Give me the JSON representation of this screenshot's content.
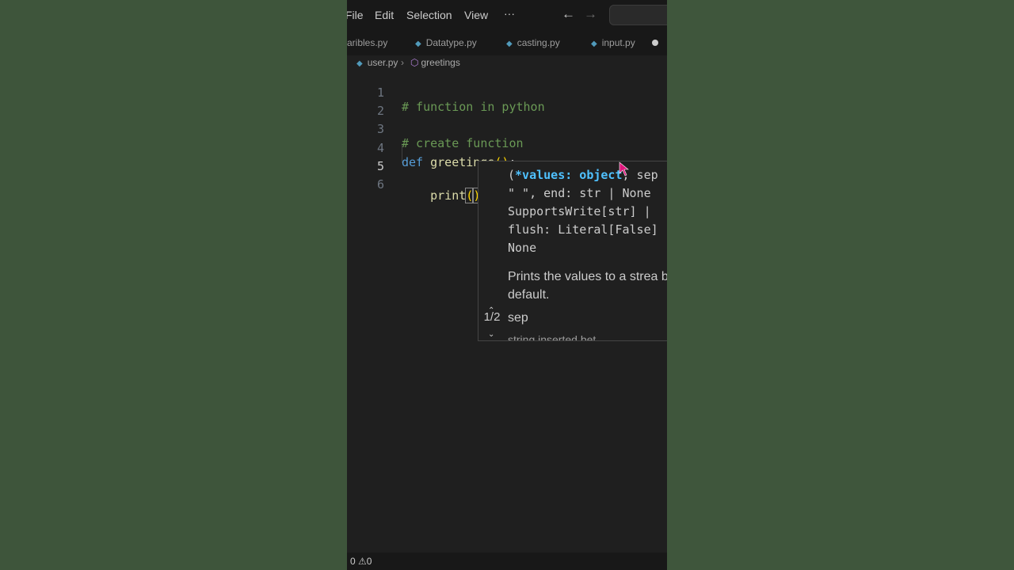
{
  "menubar": {
    "items": [
      "File",
      "Edit",
      "Selection",
      "View",
      "···"
    ],
    "back_icon": "arrow-left-icon",
    "forward_icon": "arrow-right-icon"
  },
  "tabs": [
    {
      "label": "aribles.py"
    },
    {
      "label": "Datatype.py"
    },
    {
      "label": "casting.py"
    },
    {
      "label": "input.py"
    }
  ],
  "breadcrumb": {
    "file": "user.py",
    "symbol": "greetings"
  },
  "editor": {
    "lines": [
      {
        "num": "1",
        "comment": "# function in python"
      },
      {
        "num": "2"
      },
      {
        "num": "3",
        "comment": "# create function"
      },
      {
        "num": "4",
        "keyword": "def",
        "name": "greetings",
        "parens": "()",
        "colon": ":"
      },
      {
        "num": "5",
        "indent": "    ",
        "call": "print",
        "open": "(",
        "close": ")"
      },
      {
        "num": "6"
      }
    ]
  },
  "signature_help": {
    "open_paren": "(",
    "active_param": "*values: object",
    "rest_line1": ", sep",
    "line2": "\" \", end: str | None",
    "line3": "SupportsWrite[str] |",
    "line4": "flush: Literal[False]",
    "line5": "None",
    "doc": "Prints the values to a strea by default.",
    "param_name": "sep",
    "param_desc": "  string inserted bet",
    "overload": "1/2"
  },
  "status": {
    "errors": "0",
    "warnings": "0"
  },
  "colors": {
    "editor_bg": "#1f1f1f",
    "comment": "#6a9955",
    "keyword": "#569cd6",
    "function": "#dcdcaa",
    "bracket": "#ffd700",
    "active_param": "#4fc1ff"
  }
}
